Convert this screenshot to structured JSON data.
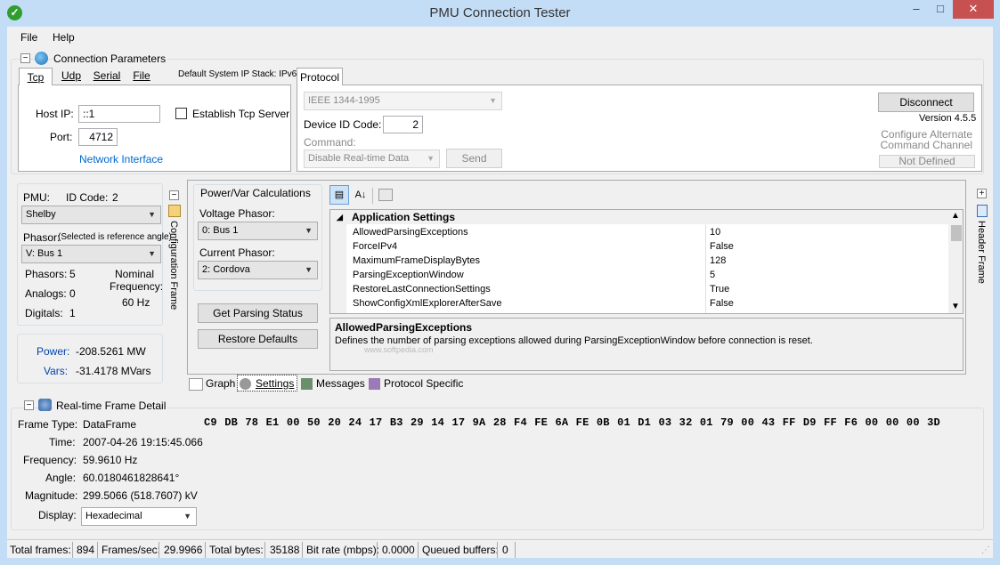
{
  "window": {
    "title": "PMU Connection Tester",
    "minimize": "–",
    "maximize": "□",
    "close": "✕"
  },
  "menu": {
    "file": "File",
    "help": "Help"
  },
  "connection": {
    "group_title": "Connection Parameters",
    "tabs": [
      "Tcp",
      "Udp",
      "Serial",
      "File"
    ],
    "ip_stack": "Default System IP Stack: IPv6",
    "host_ip_label": "Host IP:",
    "host_ip_value": "::1",
    "establish_server_label": "Establish Tcp Server",
    "port_label": "Port:",
    "port_value": "4712",
    "network_interface": "Network Interface"
  },
  "protocol": {
    "tab": "Protocol",
    "selected": "IEEE 1344-1995",
    "device_id_label": "Device ID Code:",
    "device_id_value": "2",
    "command_label": "Command:",
    "command_value": "Disable Real-time Data",
    "send": "Send",
    "disconnect": "Disconnect",
    "version": "Version 4.5.5",
    "alt_channel": "Configure Alternate Command Channel",
    "not_defined": "Not Defined"
  },
  "pmu": {
    "pmu_label": "PMU:",
    "id_code_label": "ID Code:",
    "id_code_value": "2",
    "pmu_value": "Shelby",
    "phasor_label": "Phasor:",
    "phasor_note": "(Selected is reference angle)",
    "phasor_value": "V: Bus 1",
    "phasors_label": "Phasors:",
    "phasors_value": "5",
    "analogs_label": "Analogs:",
    "analogs_value": "0",
    "digitals_label": "Digitals:",
    "digitals_value": "1",
    "nominal_label": "Nominal",
    "frequency_label": "Frequency:",
    "nominal_value": "60 Hz",
    "config_frame": "Configuration Frame",
    "power_label": "Power:",
    "power_value": "-208.5261 MW",
    "vars_label": "Vars:",
    "vars_value": "-31.4178 MVars"
  },
  "powervar": {
    "title": "Power/Var Calculations",
    "voltage_label": "Voltage Phasor:",
    "voltage_value": "0: Bus 1",
    "current_label": "Current Phasor:",
    "current_value": "2: Cordova",
    "get_status": "Get Parsing Status",
    "restore": "Restore Defaults"
  },
  "settings": {
    "category": "Application Settings",
    "rows": [
      {
        "name": "AllowedParsingExceptions",
        "value": "10"
      },
      {
        "name": "ForceIPv4",
        "value": "False"
      },
      {
        "name": "MaximumFrameDisplayBytes",
        "value": "128"
      },
      {
        "name": "ParsingExceptionWindow",
        "value": "5"
      },
      {
        "name": "RestoreLastConnectionSettings",
        "value": "True"
      },
      {
        "name": "ShowConfigXmlExplorerAfterSave",
        "value": "False"
      }
    ],
    "desc_title": "AllowedParsingExceptions",
    "desc_text": "Defines the number of parsing exceptions allowed during ParsingExceptionWindow before connection is reset.",
    "watermark": "www.softpedia.com"
  },
  "bottom_tabs": [
    "Graph",
    "Settings",
    "Messages",
    "Protocol Specific"
  ],
  "header_frame": "Header Frame",
  "realtime": {
    "title": "Real-time Frame Detail",
    "frame_type_label": "Frame Type:",
    "frame_type_value": "DataFrame",
    "time_label": "Time:",
    "time_value": "2007-04-26 19:15:45.066",
    "frequency_label": "Frequency:",
    "frequency_value": "59.9610 Hz",
    "angle_label": "Angle:",
    "angle_value": "60.0180461828641°",
    "magnitude_label": "Magnitude:",
    "magnitude_value": "299.5066 (518.7607) kV",
    "display_label": "Display:",
    "display_value": "Hexadecimal",
    "hex_bytes": "C9 DB 78 E1 00 50 20 24 17 B3 29 14 17 9A 28 F4 FE 6A FE 0B 01 D1 03 32 01 79 00 43 FF D9 FF F6 00 00 00 3D"
  },
  "status": {
    "total_frames_label": "Total frames:",
    "total_frames_value": "894",
    "fps_label": "Frames/sec:",
    "fps_value": "29.9966",
    "bytes_label": "Total bytes:",
    "bytes_value": "35188",
    "bitrate_label": "Bit rate (mbps):",
    "bitrate_value": "0.0000",
    "queued_label": "Queued buffers:",
    "queued_value": "0"
  },
  "colors": {
    "title_bg": "#c4ddf6",
    "link": "#0066cc",
    "power_text": "#0044aa",
    "close_btn": "#c75050"
  }
}
